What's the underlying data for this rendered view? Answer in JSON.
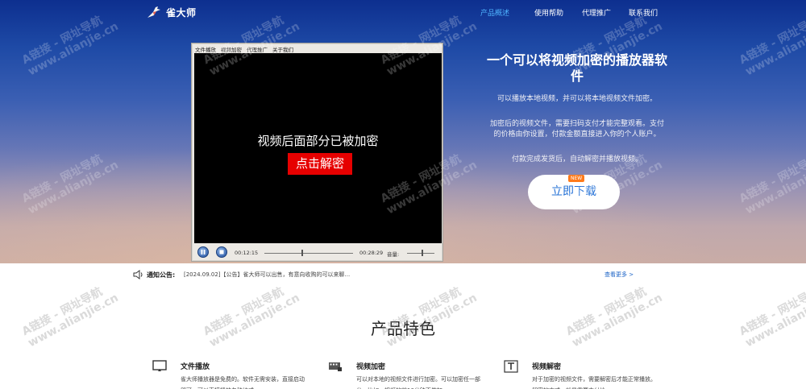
{
  "nav": {
    "brand": "雀大师",
    "links": [
      {
        "label": "产品概述",
        "active": true
      },
      {
        "label": "使用帮助",
        "active": false
      },
      {
        "label": "代理推广",
        "active": false
      },
      {
        "label": "联系我们",
        "active": false
      }
    ]
  },
  "player": {
    "menu": [
      "文件播放",
      "视频加密",
      "代理推广",
      "关于我们"
    ],
    "message": "视频后面部分已被加密",
    "unlock_label": "点击解密",
    "current_time": "00:12:15",
    "total_time": "00:28:29",
    "volume_label": "音量:",
    "progress": 0.43,
    "volume": 0.55
  },
  "hero": {
    "title": "一个可以将视频加密的播放器软件",
    "desc1": "可以播放本地视频，并可以将本地视频文件加密。",
    "desc2": "加密后的视频文件，需要扫码支付才能完整观看。支付的价格由你设置，付款金额直接进入你的个人账户。",
    "desc3": "付款完成发货后，自动解密并播放视频。",
    "download_label": "立即下载",
    "badge": "NEW"
  },
  "notice": {
    "label": "通知公告:",
    "text": "[2024.09.02]【公告】雀大师可以出售，有意向收购的可以来聊...",
    "more": "查看更多 >"
  },
  "features": {
    "title": "产品特色",
    "items": [
      {
        "icon": "monitor-play-icon",
        "title": "文件播放",
        "desc": "雀大师播放器是免费的。软件无需安装，直接启动即可，可以直接播放各种格式..."
      },
      {
        "icon": "film-lock-icon",
        "title": "视频加密",
        "desc": "可以对本地的视频文件进行加密。可以加密任一部分，比如，视频的前10分钟不做加..."
      },
      {
        "icon": "text-box-icon",
        "title": "视频解密",
        "desc": "对于加密的视频文件，需要解密后才能正常播放。解密的方式，就是需要支付给..."
      }
    ]
  },
  "watermark": {
    "line1": "A链接 - 网址导航",
    "line2": "www.alianjie.cn"
  }
}
